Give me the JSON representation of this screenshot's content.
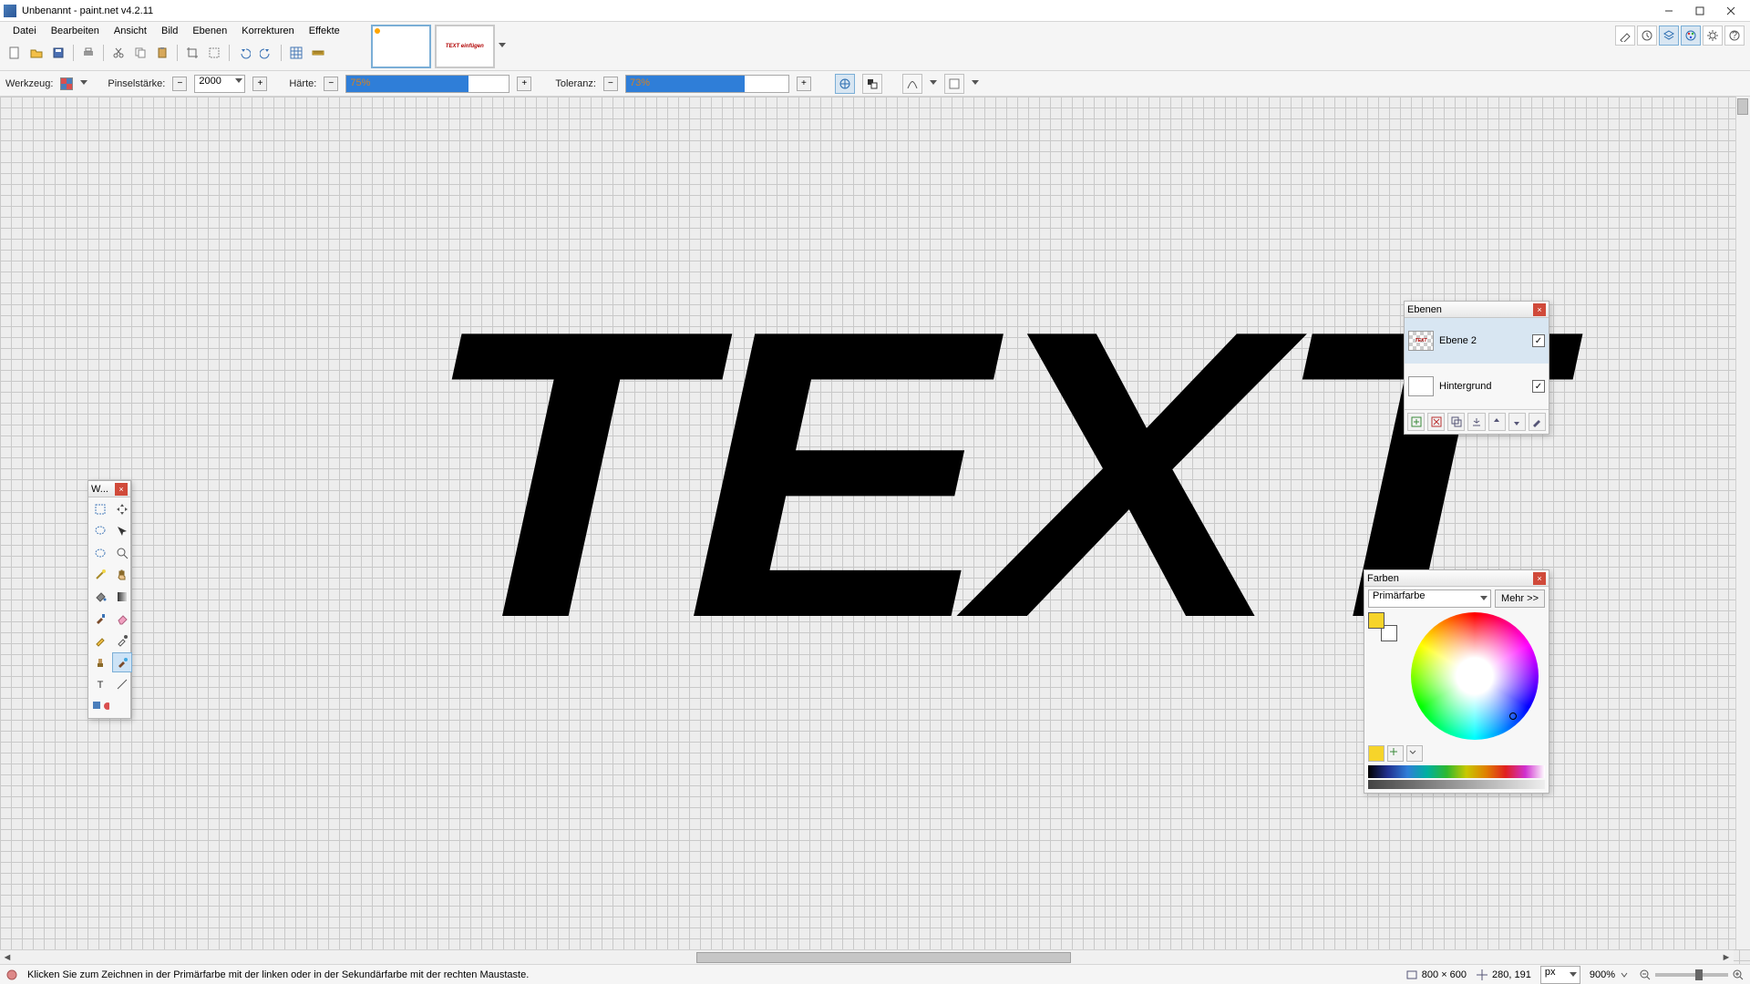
{
  "app": {
    "title": "Unbenannt - paint.net v4.2.11"
  },
  "menus": [
    "Datei",
    "Bearbeiten",
    "Ansicht",
    "Bild",
    "Ebenen",
    "Korrekturen",
    "Effekte"
  ],
  "tool_opts": {
    "tool_label": "Werkzeug:",
    "brush_label": "Pinselstärke:",
    "brush_value": "2000",
    "hardness_label": "Härte:",
    "hardness_value": "75%",
    "hardness_pct": 75,
    "tolerance_label": "Toleranz:",
    "tolerance_value": "73%",
    "tolerance_pct": 73
  },
  "canvas": {
    "big_text": "TEXT"
  },
  "tools_palette": {
    "title": "W..."
  },
  "layers": {
    "title": "Ebenen",
    "rows": [
      {
        "name": "Ebene 2",
        "visible": true
      },
      {
        "name": "Hintergrund",
        "visible": true
      }
    ]
  },
  "colors": {
    "title": "Farben",
    "which": "Primärfarbe",
    "more": "Mehr >>",
    "fg": "#f6d42a",
    "bg": "#ffffff"
  },
  "status": {
    "hint": "Klicken Sie zum Zeichnen in der Primärfarbe mit der linken oder in der Sekundärfarbe mit der rechten Maustaste.",
    "doc_size": "800 × 600",
    "cursor": "280, 191",
    "unit": "px",
    "zoom": "900%"
  },
  "thumb_label": "TEXT einfügen"
}
